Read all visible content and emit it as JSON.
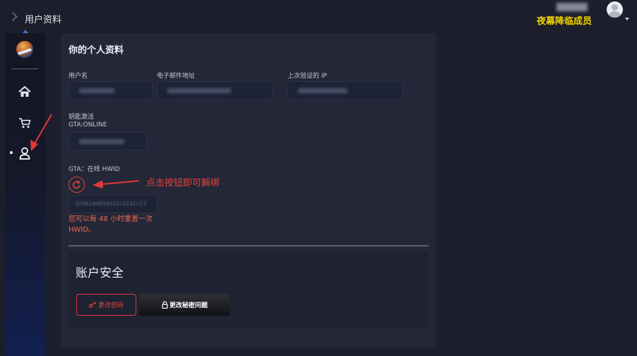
{
  "header": {
    "breadcrumb_title": "用户资料",
    "user_role": "夜幕降临成员"
  },
  "sidebar": {
    "items": [
      {
        "name": "home",
        "icon": "home-icon"
      },
      {
        "name": "cart",
        "icon": "cart-icon"
      },
      {
        "name": "profile",
        "icon": "user-icon",
        "active": true
      }
    ]
  },
  "profile": {
    "title": "你的个人资料",
    "username_label": "用户名",
    "email_label": "电子邮件地址",
    "last_ip_label": "上次验证的 IP",
    "key_label": "钥匙激活",
    "key_product": "GTA:ONLINE",
    "hwid_label": "GTA：在线 HWID",
    "hwid_value": "32462dd83d332c3242c23",
    "hwid_hint": "您可以每 48 小时重置一次 HWID。"
  },
  "security": {
    "title": "账户安全",
    "change_password_label": "更改密码",
    "change_question_label": "更改秘密问题"
  },
  "annotation": {
    "text": "点击按钮即可解绑"
  },
  "colors": {
    "accent_red": "#e2453a",
    "role_yellow": "#f1d500",
    "background": "#1c1e2b",
    "card": "#232737"
  }
}
